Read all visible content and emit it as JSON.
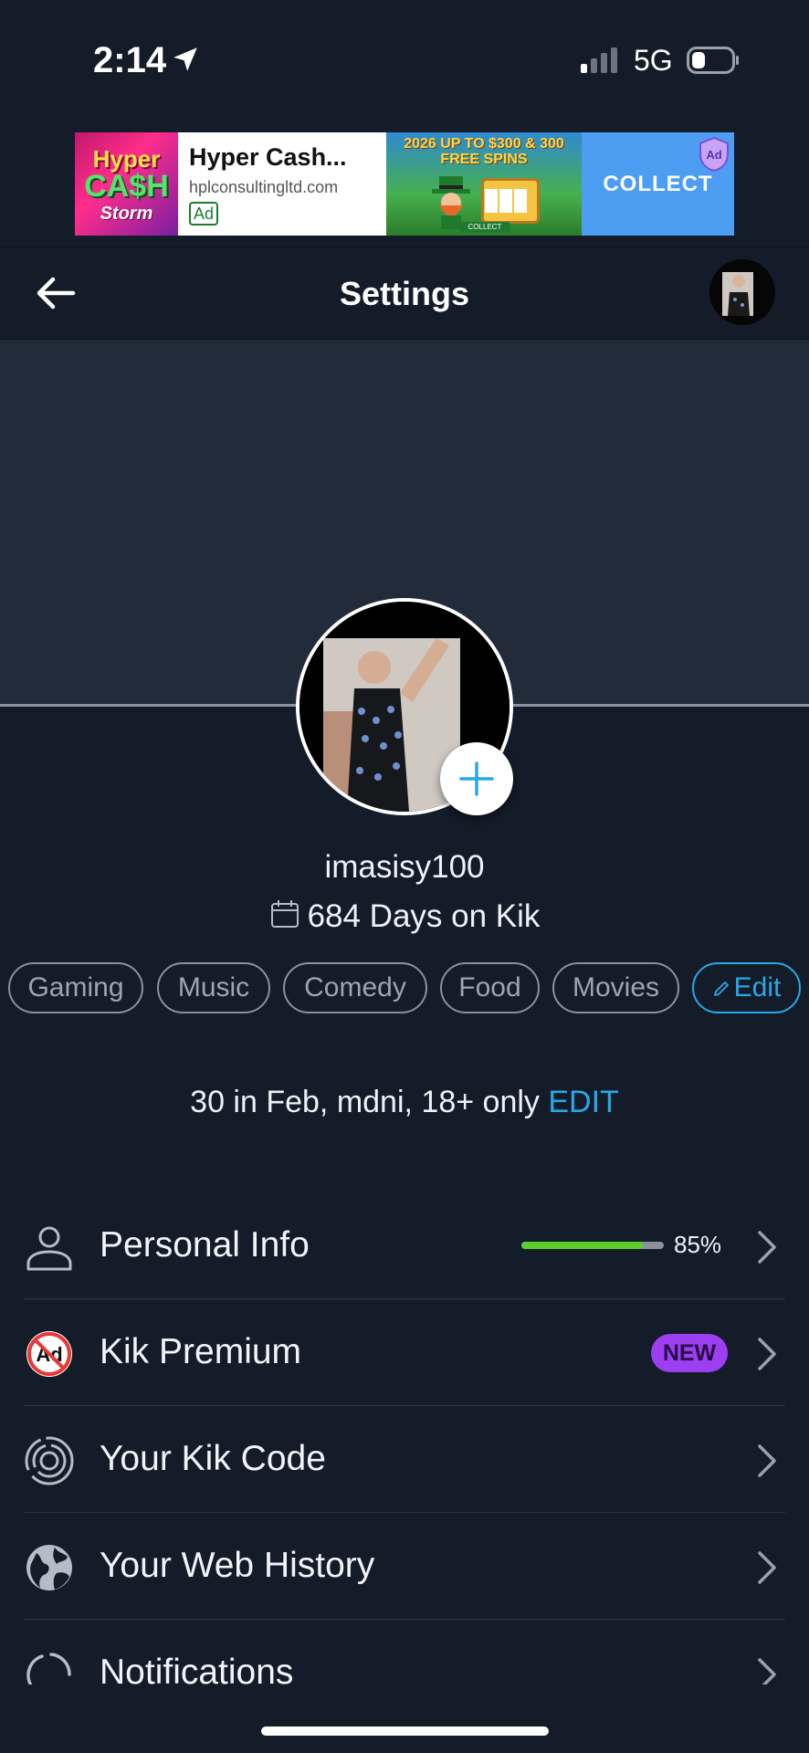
{
  "status_bar": {
    "time": "2:14",
    "network": "5G"
  },
  "ad": {
    "thumb_line1": "Hyper",
    "thumb_line2": "CA$H",
    "thumb_line3": "Storm",
    "title": "Hyper Cash...",
    "domain": "hplconsultingltd.com",
    "badge": "Ad",
    "art_headline": "2026 UP TO $300 & 300 FREE SPINS",
    "art_button": "COLLECT",
    "cta": "COLLECT",
    "choice_label": "Ad"
  },
  "nav": {
    "title": "Settings"
  },
  "profile": {
    "username": "imasisy100",
    "days_on_kik": "684 Days on Kik",
    "interests": [
      "Gaming",
      "Music",
      "Comedy",
      "Food",
      "Movies"
    ],
    "edit_interests_label": "Edit",
    "bio": "30 in Feb, mdni, 18+ only",
    "bio_edit_label": "EDIT"
  },
  "menu": {
    "items": [
      {
        "label": "Personal Info",
        "icon": "person-icon",
        "progress_percent": 85,
        "progress_text": "85%"
      },
      {
        "label": "Kik Premium",
        "icon": "no-ads-icon",
        "badge": "NEW"
      },
      {
        "label": "Your Kik Code",
        "icon": "kik-code-icon"
      },
      {
        "label": "Your Web History",
        "icon": "globe-icon"
      },
      {
        "label": "Notifications",
        "icon": "notifications-icon"
      }
    ]
  },
  "colors": {
    "background": "#141c29",
    "cover": "#222b3a",
    "accent": "#2aa7e6",
    "progress": "#5ccf2d",
    "new_badge": "#9c3ff0"
  }
}
